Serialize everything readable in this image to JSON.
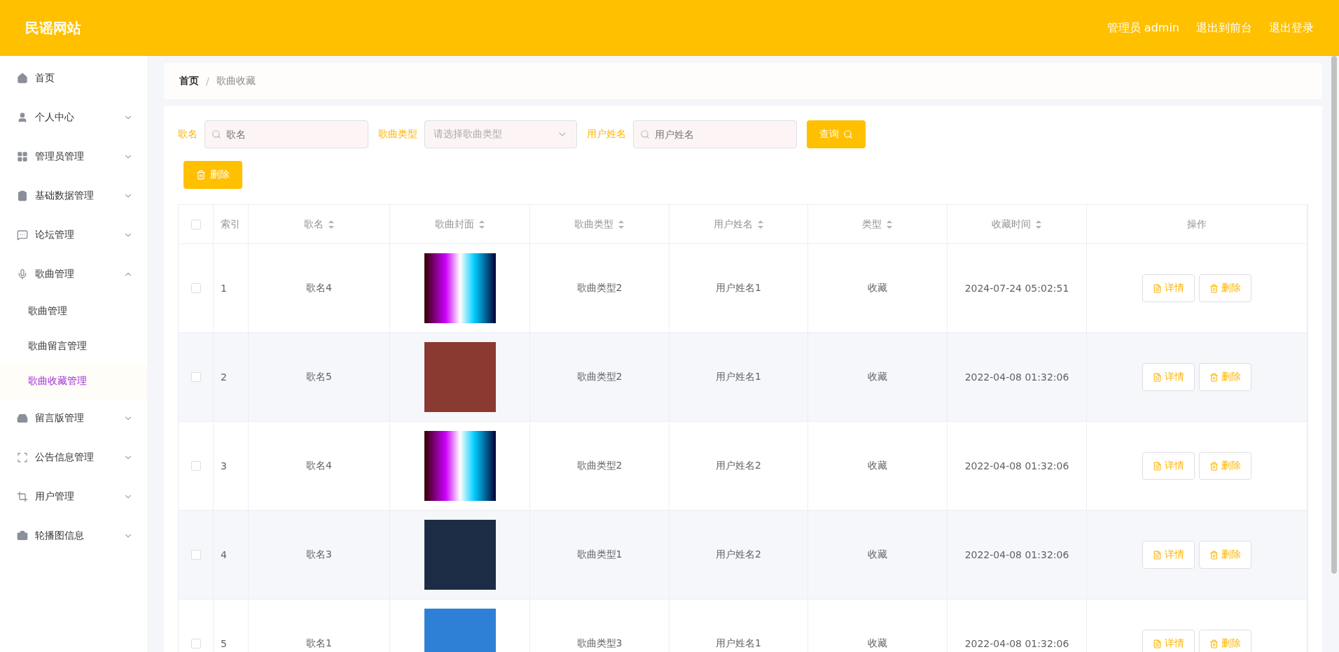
{
  "header": {
    "title": "民谣网站",
    "links": [
      "管理员 admin",
      "退出到前台",
      "退出登录"
    ]
  },
  "sidebar": {
    "items": [
      {
        "label": "首页",
        "selected": false
      },
      {
        "label": "个人中心",
        "selected": false,
        "expanded": false
      },
      {
        "label": "管理员管理",
        "selected": false,
        "expanded": false
      },
      {
        "label": "基础数据管理",
        "selected": false,
        "expanded": false
      },
      {
        "label": "论坛管理",
        "selected": false,
        "expanded": false
      },
      {
        "label": "歌曲管理",
        "selected": false,
        "expanded": true,
        "children": [
          {
            "label": "歌曲管理",
            "selected": false
          },
          {
            "label": "歌曲留言管理",
            "selected": false
          },
          {
            "label": "歌曲收藏管理",
            "selected": true
          }
        ]
      },
      {
        "label": "留言版管理",
        "selected": false,
        "expanded": false
      },
      {
        "label": "公告信息管理",
        "selected": false,
        "expanded": false
      },
      {
        "label": "用户管理",
        "selected": false,
        "expanded": false
      },
      {
        "label": "轮播图信息",
        "selected": false,
        "expanded": false
      }
    ]
  },
  "breadcrumb": [
    "首页",
    "/",
    "歌曲收藏"
  ],
  "search": {
    "fields": [
      {
        "label": "歌名",
        "kind": "text",
        "placeholder": "歌名"
      },
      {
        "label": "歌曲类型",
        "kind": "select",
        "placeholder": "请选择歌曲类型"
      },
      {
        "label": "用户姓名",
        "kind": "text",
        "placeholder": "用户姓名"
      }
    ],
    "button": "查询"
  },
  "delete_button": "删除",
  "table": {
    "select_all": {
      "checked": false
    },
    "columns": [
      {
        "label": "索引",
        "sortable": false
      },
      {
        "label": "歌名",
        "sortable": true
      },
      {
        "label": "歌曲封面",
        "sortable": true
      },
      {
        "label": "歌曲类型",
        "sortable": true
      },
      {
        "label": "用户姓名",
        "sortable": true
      },
      {
        "label": "类型",
        "sortable": true
      },
      {
        "label": "收藏时间",
        "sortable": true
      },
      {
        "label": "操作",
        "sortable": false
      }
    ],
    "rows": [
      {
        "checked": false,
        "index": "1",
        "name": "歌名4",
        "type": "歌曲类型2",
        "user": "用户姓名1",
        "kind": "收藏",
        "time": "2024-07-24 05:02:51",
        "actions": [
          "详情",
          "删除"
        ]
      },
      {
        "checked": false,
        "index": "2",
        "name": "歌名5",
        "type": "歌曲类型2",
        "user": "用户姓名1",
        "kind": "收藏",
        "time": "2022-04-08 01:32:06",
        "actions": [
          "详情",
          "删除"
        ]
      },
      {
        "checked": false,
        "index": "3",
        "name": "歌名4",
        "type": "歌曲类型2",
        "user": "用户姓名2",
        "kind": "收藏",
        "time": "2022-04-08 01:32:06",
        "actions": [
          "详情",
          "删除"
        ]
      },
      {
        "checked": false,
        "index": "4",
        "name": "歌名3",
        "type": "歌曲类型1",
        "user": "用户姓名2",
        "kind": "收藏",
        "time": "2022-04-08 01:32:06",
        "actions": [
          "详情",
          "删除"
        ]
      },
      {
        "checked": false,
        "index": "5",
        "name": "歌名1",
        "type": "歌曲类型3",
        "user": "用户姓名1",
        "kind": "收藏",
        "time": "2022-04-08 01:32:06",
        "actions": [
          "详情",
          "删除"
        ]
      }
    ]
  }
}
